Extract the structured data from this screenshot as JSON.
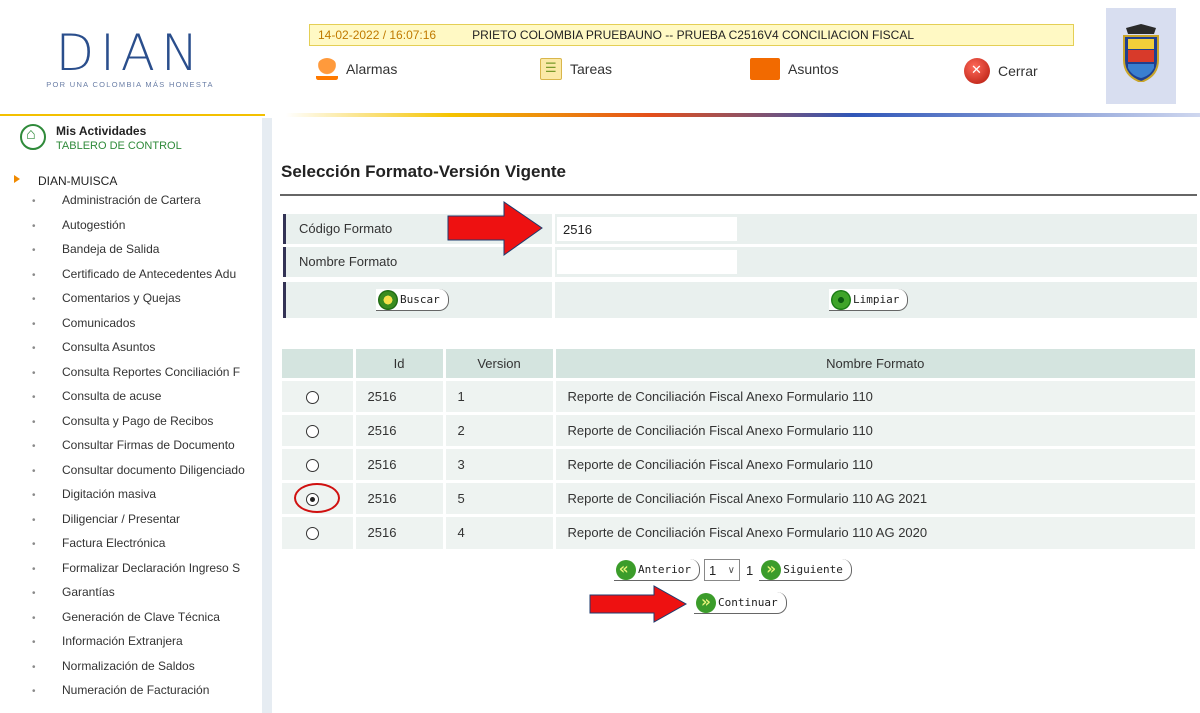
{
  "header": {
    "logo_text": "DIAN",
    "logo_slogan": "POR UNA COLOMBIA MÁS HONESTA",
    "datetime": "14-02-2022 / 16:07:16",
    "user_info": "PRIETO COLOMBIA PRUEBAUNO -- PRUEBA C2516V4 CONCILIACION FISCAL",
    "nav": {
      "alarmas": "Alarmas",
      "tareas": "Tareas",
      "asuntos": "Asuntos",
      "cerrar": "Cerrar"
    }
  },
  "sidebar": {
    "activities_title": "Mis Actividades",
    "activities_sub": "TABLERO DE CONTROL",
    "section": "DIAN-MUISCA",
    "items": [
      "Administración de Cartera",
      "Autogestión",
      "Bandeja de Salida",
      "Certificado de Antecedentes Adu",
      "Comentarios y Quejas",
      "Comunicados",
      "Consulta Asuntos",
      "Consulta Reportes Conciliación F",
      "Consulta de acuse",
      "Consulta y Pago de Recibos",
      "Consultar Firmas de Documento",
      "Consultar documento Diligenciado",
      "Digitación masiva",
      "Diligenciar / Presentar",
      "Factura Electrónica",
      "Formalizar Declaración Ingreso S",
      "Garantías",
      "Generación de Clave Técnica",
      "Información Extranjera",
      "Normalización de Saldos",
      "Numeración de Facturación"
    ]
  },
  "main": {
    "title": "Selección Formato-Versión Vigente",
    "codigo_label": "Código Formato",
    "codigo_value": "2516",
    "nombre_label": "Nombre Formato",
    "nombre_value": "",
    "buscar": "Buscar",
    "limpiar": "Limpiar",
    "table": {
      "headers": [
        "",
        "Id",
        "Version",
        "Nombre Formato"
      ],
      "rows": [
        {
          "selected": false,
          "id": "2516",
          "version": "1",
          "nombre": "Reporte de Conciliación Fiscal Anexo Formulario 110"
        },
        {
          "selected": false,
          "id": "2516",
          "version": "2",
          "nombre": "Reporte de Conciliación Fiscal Anexo Formulario 110"
        },
        {
          "selected": false,
          "id": "2516",
          "version": "3",
          "nombre": "Reporte de Conciliación Fiscal Anexo Formulario 110"
        },
        {
          "selected": true,
          "id": "2516",
          "version": "5",
          "nombre": "Reporte de Conciliación Fiscal Anexo Formulario 110 AG 2021"
        },
        {
          "selected": false,
          "id": "2516",
          "version": "4",
          "nombre": "Reporte de Conciliación Fiscal Anexo Formulario 110 AG 2020"
        }
      ]
    },
    "pager": {
      "anterior": "Anterior",
      "page": "1",
      "total": "1",
      "siguiente": "Siguiente"
    },
    "continuar": "Continuar"
  },
  "colors": {
    "accent_green": "#2f8a3a",
    "arrow_red": "#ee1111",
    "dian_blue": "#2a4e8c"
  }
}
